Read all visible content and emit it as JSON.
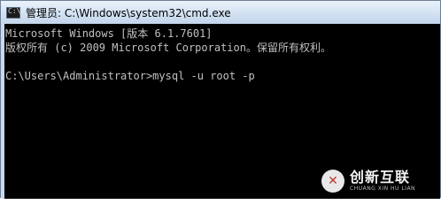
{
  "window": {
    "title": "管理员: C:\\Windows\\system32\\cmd.exe",
    "icon": "cmd-icon"
  },
  "console": {
    "lines": [
      "Microsoft Windows [版本 6.1.7601]",
      "版权所有 (c) 2009 Microsoft Corporation。保留所有权利。",
      "",
      "C:\\Users\\Administrator>mysql -u root -p"
    ]
  },
  "watermark": {
    "main": "创新互联",
    "sub": "CHUANG XIN HU LIAN"
  }
}
